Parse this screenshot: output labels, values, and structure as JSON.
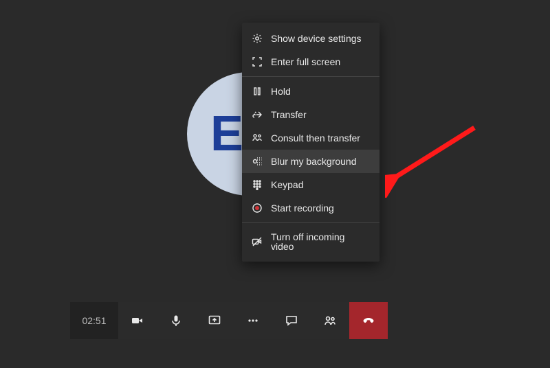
{
  "avatar": {
    "initials": "EW"
  },
  "menu": {
    "items": [
      {
        "key": "device-settings",
        "label": "Show device settings"
      },
      {
        "key": "fullscreen",
        "label": "Enter full screen"
      },
      {
        "key": "hold",
        "label": "Hold"
      },
      {
        "key": "transfer",
        "label": "Transfer"
      },
      {
        "key": "consult-transfer",
        "label": "Consult then transfer"
      },
      {
        "key": "blur-bg",
        "label": "Blur my background",
        "hover": true
      },
      {
        "key": "keypad",
        "label": "Keypad"
      },
      {
        "key": "record",
        "label": "Start recording"
      },
      {
        "key": "incoming-video-off",
        "label": "Turn off incoming video"
      }
    ]
  },
  "toolbar": {
    "timer": "02:51"
  }
}
